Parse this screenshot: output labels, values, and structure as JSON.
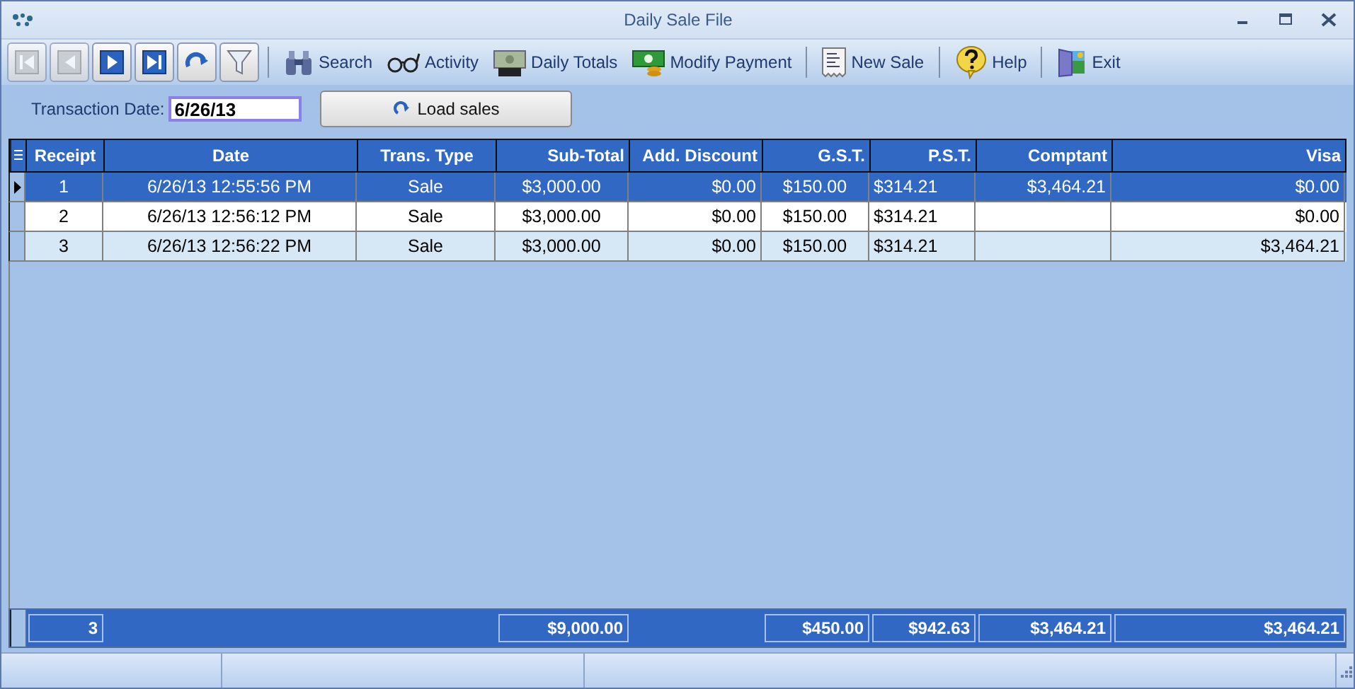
{
  "window": {
    "title": "Daily Sale File"
  },
  "nav_buttons": [
    {
      "kind": "first",
      "disabled": true
    },
    {
      "kind": "prev",
      "disabled": true
    },
    {
      "kind": "next",
      "disabled": false
    },
    {
      "kind": "last",
      "disabled": false
    },
    {
      "kind": "refresh",
      "disabled": false
    },
    {
      "kind": "filter",
      "disabled": false
    }
  ],
  "toolbar": [
    {
      "kind": "search",
      "label": "Search"
    },
    {
      "kind": "activity",
      "label": "Activity"
    },
    {
      "kind": "totals",
      "label": "Daily Totals"
    },
    {
      "kind": "payment",
      "label": "Modify Payment"
    },
    {
      "kind": "newsale",
      "label": "New Sale"
    },
    {
      "kind": "help",
      "label": "Help"
    },
    {
      "kind": "exit",
      "label": "Exit"
    }
  ],
  "transaction_date": {
    "label": "Transaction Date:",
    "value": "6/26/13"
  },
  "load_button": {
    "label": "Load sales"
  },
  "table": {
    "columns": [
      "Receipt",
      "Date",
      "Trans. Type",
      "Sub-Total",
      "Add. Discount",
      "G.S.T.",
      "P.S.T.",
      "Comptant",
      "Visa"
    ],
    "rows": [
      {
        "selected": true,
        "cells": [
          "1",
          "6/26/13 12:55:56 PM",
          "Sale",
          "$3,000.00",
          "$0.00",
          "$150.00",
          "$314.21",
          "$3,464.21",
          "$0.00"
        ]
      },
      {
        "selected": false,
        "cells": [
          "2",
          "6/26/13 12:56:12 PM",
          "Sale",
          "$3,000.00",
          "$0.00",
          "$150.00",
          "$314.21",
          null,
          "$0.00"
        ]
      },
      {
        "selected": false,
        "cells": [
          "3",
          "6/26/13 12:56:22 PM",
          "Sale",
          "$3,000.00",
          "$0.00",
          "$150.00",
          "$314.21",
          null,
          "$3,464.21"
        ]
      }
    ],
    "totals": {
      "receipt": "3",
      "sub_total": "$9,000.00",
      "gst": "$450.00",
      "pst": "$942.63",
      "comptant": "$3,464.21",
      "visa": "$3,464.21"
    }
  }
}
